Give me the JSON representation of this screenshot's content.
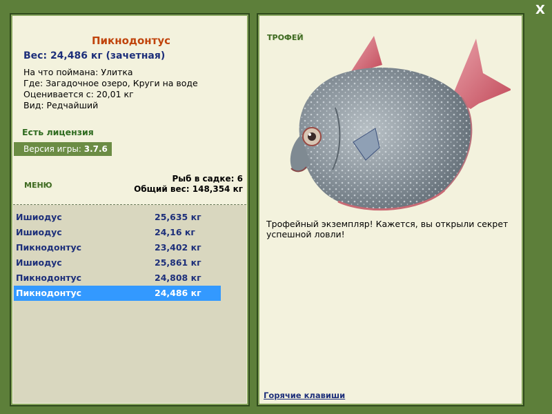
{
  "close_label": "X",
  "fish": {
    "name": "Пикнодонтус",
    "weight_line": "Вес: 24,486 кг (зачетная)",
    "bait_line": "На что поймана: Улитка",
    "place_line": "Где: Загадочное озеро, Круги на воде",
    "value_line": "Оценивается с: 20,01 кг",
    "kind_line": "Вид: Редчайший"
  },
  "license_text": "Есть лицензия",
  "version": {
    "label": "Версия игры: ",
    "value": "3.7.6"
  },
  "menu_label": "МЕНЮ",
  "keep": {
    "count_line": "Рыб в садке: 6",
    "total_line": "Общий вес: 148,354 кг"
  },
  "catches": [
    {
      "name": "Ишиодус",
      "weight": "25,635 кг"
    },
    {
      "name": "Ишиодус",
      "weight": "24,16 кг"
    },
    {
      "name": "Пикнодонтус",
      "weight": "23,402 кг"
    },
    {
      "name": "Ишиодус",
      "weight": "25,861 кг"
    },
    {
      "name": "Пикнодонтус",
      "weight": "24,808 кг"
    },
    {
      "name": "Пикнодонтус",
      "weight": "24,486 кг"
    }
  ],
  "selected_catch": 5,
  "trophy_label": "ТРОФЕЙ",
  "trophy_message": "Трофейный экземпляр! Кажется, вы открыли секрет успешной ловли!",
  "hotkeys_label": "Горячие клавиши",
  "colors": {
    "frame": "#5d7f3a",
    "panel": "#f3f2dd",
    "accent_title": "#c0440c",
    "text_blue": "#1d2f7a",
    "selection": "#3399ff"
  },
  "icons": {
    "close": "close-icon",
    "fish": "fish-illustration"
  }
}
